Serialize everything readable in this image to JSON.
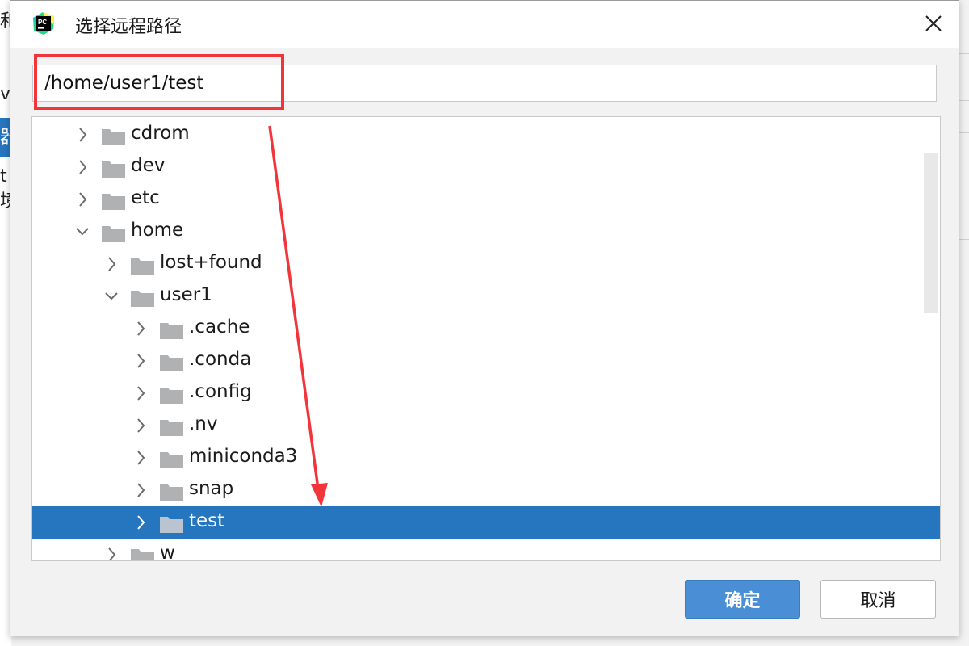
{
  "background": {
    "left_fragments": [
      "和",
      "v",
      "器",
      "t境"
    ]
  },
  "dialog": {
    "title": "选择远程路径",
    "app_icon": "pycharm-icon",
    "close_icon": "close-icon",
    "path_value": "/home/user1/test",
    "tree": [
      {
        "label": "cdrom",
        "depth": 0,
        "expanded": false,
        "selected": false
      },
      {
        "label": "dev",
        "depth": 0,
        "expanded": false,
        "selected": false
      },
      {
        "label": "etc",
        "depth": 0,
        "expanded": false,
        "selected": false
      },
      {
        "label": "home",
        "depth": 0,
        "expanded": true,
        "selected": false
      },
      {
        "label": "lost+found",
        "depth": 1,
        "expanded": false,
        "selected": false
      },
      {
        "label": "user1",
        "depth": 1,
        "expanded": true,
        "selected": false
      },
      {
        "label": ".cache",
        "depth": 2,
        "expanded": false,
        "selected": false
      },
      {
        "label": ".conda",
        "depth": 2,
        "expanded": false,
        "selected": false
      },
      {
        "label": ".config",
        "depth": 2,
        "expanded": false,
        "selected": false
      },
      {
        "label": ".nv",
        "depth": 2,
        "expanded": false,
        "selected": false
      },
      {
        "label": "miniconda3",
        "depth": 2,
        "expanded": false,
        "selected": false
      },
      {
        "label": "snap",
        "depth": 2,
        "expanded": false,
        "selected": false
      },
      {
        "label": "test",
        "depth": 2,
        "expanded": false,
        "selected": true
      },
      {
        "label": "w",
        "depth": 1,
        "expanded": false,
        "selected": false
      }
    ],
    "ok_label": "确定",
    "cancel_label": "取消"
  },
  "colors": {
    "selection": "#2675bf",
    "primary_button": "#4a8fd6",
    "annotation": "#f2353b",
    "folder": "#afb1b3"
  }
}
